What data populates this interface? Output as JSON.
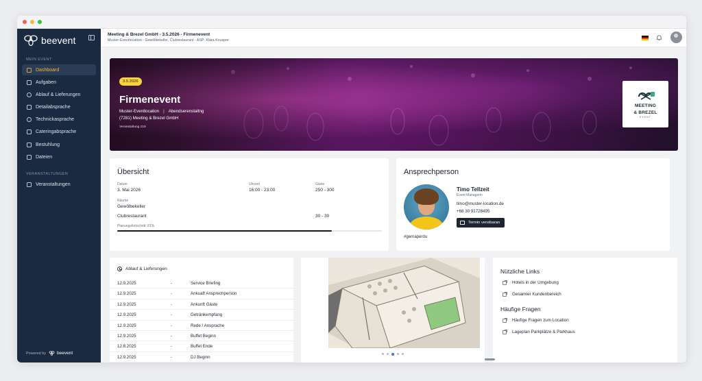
{
  "sidebar": {
    "brand": "beevent",
    "section_event": "MEIN EVENT",
    "section_events": "VERANSTALTUNGEN",
    "items": [
      {
        "label": "Dashboard"
      },
      {
        "label": "Aufgaben"
      },
      {
        "label": "Ablauf & Lieferungen"
      },
      {
        "label": "Detailabsprache"
      },
      {
        "label": "Technickasprache"
      },
      {
        "label": "Cateringabsprache"
      },
      {
        "label": "Bestuhlung"
      },
      {
        "label": "Dateien"
      }
    ],
    "events_item": "Veranstaltungen",
    "powered_by": "Powered by",
    "powered_brand": "beevent"
  },
  "header": {
    "title": "Meeting & Brezel GmbH - 3.5.2026 - Firmenevent",
    "subtitle": "Muster-Eventlocation - Gewölbekeller, Clubrestaurant - ASP: Klara Knusper"
  },
  "hero": {
    "badge": "3.5.2026",
    "title": "Firmenevent",
    "location": "Muster-Eventlocation",
    "event_type": "Abendserenstaltng",
    "separator": "|",
    "customer": "(7281) Meeting & Brezel GmbH",
    "meta": "Veranstaltung 219",
    "logo_text_1": "MEETING",
    "logo_text_2": "& BREZEL",
    "logo_sub": "EVENT"
  },
  "overview": {
    "title": "Übersicht",
    "datum_label": "Datum",
    "datum": "3. Mai 2026",
    "uhrzeit_label": "Uhrzeit",
    "uhrzeit": "16:00 - 23:00",
    "gaeste_label": "Gäste",
    "gaeste": "250 - 300",
    "raeume_label": "Räume",
    "raum1": "Gewölbekeller",
    "raum2": "Clubrestaurant",
    "raum2_gaeste": "30 - 30",
    "progress_label": "Planungsfortschritt: 81%",
    "progress": 0.81
  },
  "contact": {
    "title": "Ansprechperson",
    "name": "Timo Tellzeit",
    "role": "Event Managerin",
    "email": "timo@muster-location.de",
    "phone": "+68 30 91728495",
    "button": "Termin versibaran",
    "hashtag": "#gernaperdu"
  },
  "schedule": {
    "title": "Ablauf & Lieferungen",
    "rows": [
      {
        "date": "12.9.2025",
        "dash": "-",
        "text": "Service Briefing"
      },
      {
        "date": "12.9.2025",
        "dash": "-",
        "text": "Ankuaft Ansprechperson"
      },
      {
        "date": "12.9.2025",
        "dash": "-",
        "text": "Ankunft Gäste"
      },
      {
        "date": "12.9.2025",
        "dash": "-",
        "text": "Getränkempfang"
      },
      {
        "date": "12.9.2025",
        "dash": "-",
        "text": "Rede / Ansprache"
      },
      {
        "date": "12.9.2025",
        "dash": "-",
        "text": "Buffet Beginn"
      },
      {
        "date": "12.8.2025",
        "dash": "-",
        "text": "Buffet Ende"
      },
      {
        "date": "12.9.2025",
        "dash": "-",
        "text": "DJ Beginn"
      }
    ]
  },
  "links": {
    "title": "Nützliche Links",
    "items": [
      {
        "label": "Hotels in der Umgebung"
      },
      {
        "label": "Gesamter Kundenbereich"
      }
    ],
    "faq_title": "Häufige Fragen",
    "faq": [
      {
        "label": "Häufige Fragen zum Location"
      },
      {
        "label": "Lageplan Parkplätze & Parkhaus"
      }
    ]
  },
  "colors": {
    "sidebar": "#1a2a41",
    "active_text": "#f7b733",
    "badge": "#f8d33c"
  }
}
